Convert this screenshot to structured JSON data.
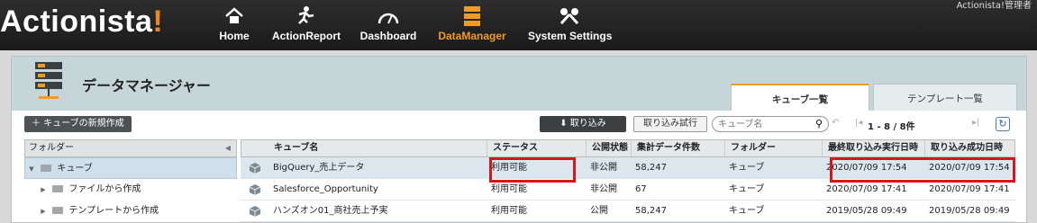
{
  "app": {
    "logo_main": "Actionista",
    "logo_bang": "!",
    "user": "Actionista!管理者"
  },
  "nav": [
    {
      "label": "Home",
      "icon": "home-icon"
    },
    {
      "label": "ActionReport",
      "icon": "runner-icon"
    },
    {
      "label": "Dashboard",
      "icon": "gauge-icon"
    },
    {
      "label": "DataManager",
      "icon": "database-icon",
      "active": true
    },
    {
      "label": "System Settings",
      "icon": "tools-icon"
    }
  ],
  "page": {
    "title": "データマネージャー"
  },
  "tabs": [
    {
      "label": "キューブ一覧",
      "active": true
    },
    {
      "label": "テンプレート一覧"
    }
  ],
  "toolbar": {
    "new_cube": "＋ キューブの新規作成",
    "import": "取り込み",
    "import_trial": "取り込み試行",
    "search_placeholder": "キューブ名",
    "pager": "1 - 8 / 8件"
  },
  "tree": {
    "header": "フォルダー",
    "items": [
      {
        "label": "キューブ",
        "level": 0
      },
      {
        "label": "ファイルから作成",
        "level": 1
      },
      {
        "label": "テンプレートから作成",
        "level": 1
      }
    ]
  },
  "table": {
    "headers": [
      "キューブ名",
      "ステータス",
      "公開状態",
      "集計データ件数",
      "フォルダー",
      "最終取り込み実行日時",
      "取り込み成功日時"
    ],
    "rows": [
      [
        "BigQuery_売上データ",
        "利用可能",
        "非公開",
        "58,247",
        "キューブ",
        "2020/07/09 17:54",
        "2020/07/09 17:54"
      ],
      [
        "Salesforce_Opportunity",
        "利用可能",
        "非公開",
        "67",
        "キューブ",
        "2020/07/09 17:41",
        "2020/07/09 17:41"
      ],
      [
        "ハンズオン01_商社売上予実",
        "利用可能",
        "公開",
        "58,247",
        "キューブ",
        "2019/05/28 09:49",
        "2019/05/28 09:49"
      ]
    ]
  },
  "colors": {
    "accent": "#f39a21",
    "highlight": "#d5161a"
  }
}
